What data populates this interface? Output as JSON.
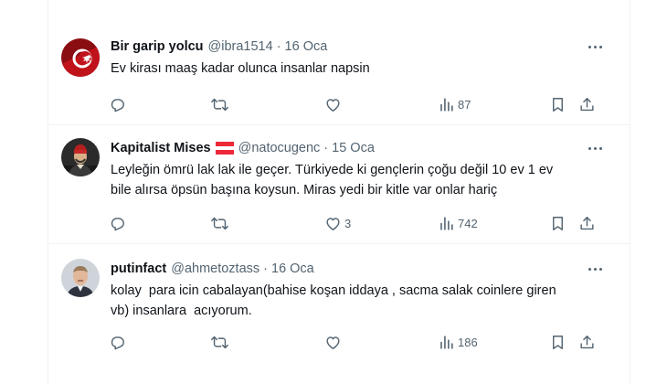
{
  "tweets": [
    {
      "name": "Bir garip yolcu",
      "handle": "@ibra1514",
      "separator": "·",
      "date": "16 Oca",
      "text": "Ev kirası maaş kadar olunca insanlar napsin",
      "reply_count": "",
      "retweet_count": "",
      "like_count": "",
      "view_count": "87"
    },
    {
      "name": "Kapitalist Mises",
      "handle": "@natocugenc",
      "separator": "·",
      "date": "15 Oca",
      "text": "Leyleğin ömrü lak lak ile geçer. Türkiyede ki gençlerin çoğu değil 10 ev 1 ev\nbile alırsa öpsün başına koysun. Miras yedi bir kitle var onlar hariç",
      "reply_count": "",
      "retweet_count": "",
      "like_count": "3",
      "view_count": "742"
    },
    {
      "name": "putinfact",
      "handle": "@ahmetoztass",
      "separator": "·",
      "date": "16 Oca",
      "text": "kolay  para icin cabalayan(bahise koşan iddaya , sacma salak coinlere giren\nvb) insanlara  acıyorum.",
      "reply_count": "",
      "retweet_count": "",
      "like_count": "",
      "view_count": "186"
    }
  ],
  "colors": {
    "text": "#0f1419",
    "muted": "#536471",
    "border": "#eff3f4",
    "flag_red": "#ed2939"
  },
  "icons": [
    "reply-icon",
    "retweet-icon",
    "like-icon",
    "views-icon",
    "bookmark-icon",
    "share-icon",
    "more-icon"
  ]
}
